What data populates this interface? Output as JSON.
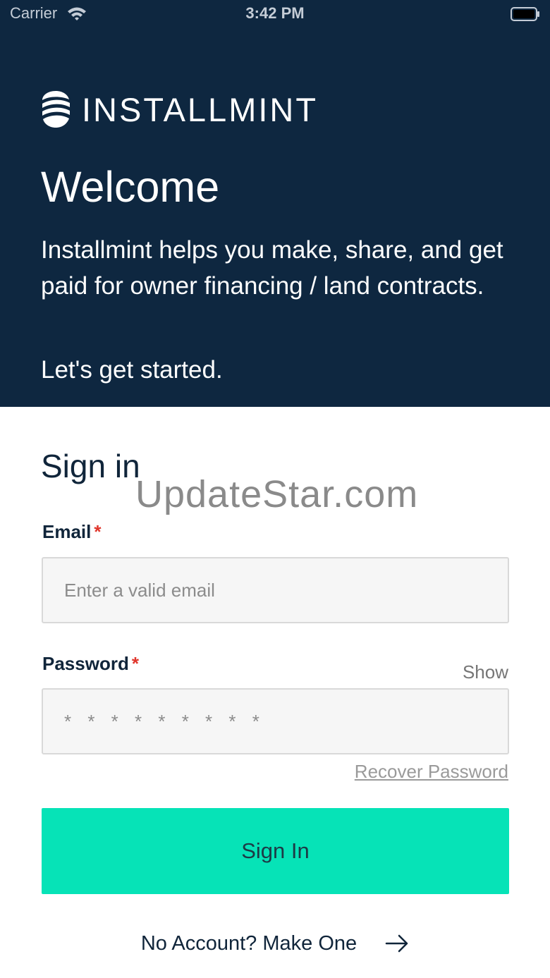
{
  "status_bar": {
    "carrier": "Carrier",
    "time": "3:42 PM",
    "icons": [
      "wifi-icon",
      "battery-icon"
    ]
  },
  "brand": {
    "name": "INSTALLMINT",
    "icon": "installmint-logo-icon"
  },
  "hero": {
    "title": "Welcome",
    "description": "Installmint helps you make, share, and get paid for owner financing / land contracts.",
    "cta_text": "Let's get started."
  },
  "watermark": "UpdateStar.com",
  "sign_in": {
    "title": "Sign in",
    "email": {
      "label": "Email",
      "required_mark": "*",
      "placeholder": "Enter a valid email",
      "value": ""
    },
    "password": {
      "label": "Password",
      "required_mark": "*",
      "placeholder": "* * * * * * * * *",
      "value": "",
      "show_toggle": "Show"
    },
    "recover_link": "Recover Password",
    "submit_label": "Sign In",
    "no_account_link": "No Account? Make One",
    "arrow_icon": "arrow-right-icon"
  },
  "colors": {
    "hero_background": "#0e2740",
    "accent": "#06e3b7",
    "text_dark": "#10253a",
    "required": "#e0352b"
  }
}
